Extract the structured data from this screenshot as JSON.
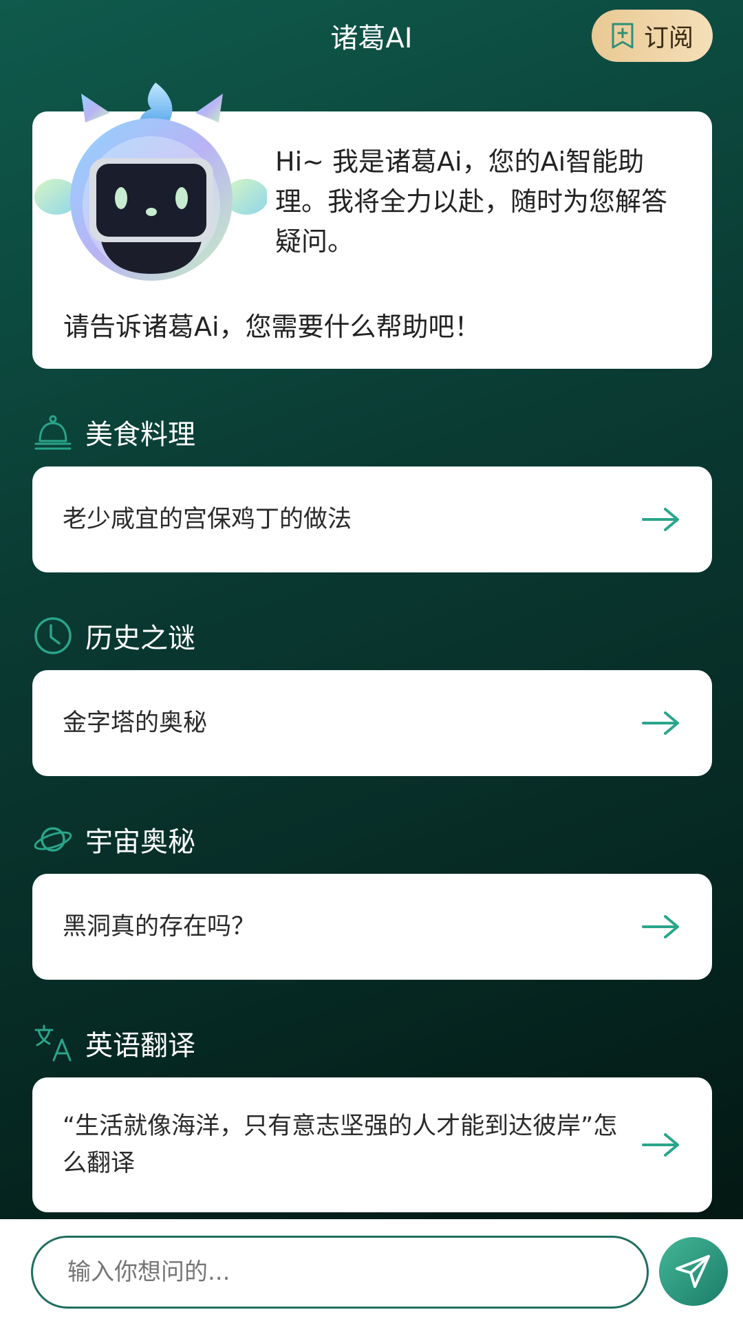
{
  "header": {
    "title": "诸葛AI",
    "subscribe_label": "订阅"
  },
  "welcome": {
    "intro": "Hi~ 我是诸葛Ai，您的Ai智能助理。我将全力以赴，随时为您解答疑问。",
    "prompt": "请告诉诸葛Ai，您需要什么帮助吧！"
  },
  "sections": [
    {
      "title": "美食料理",
      "icon": "bell-cloche-icon",
      "suggestion": "老少咸宜的宫保鸡丁的做法"
    },
    {
      "title": "历史之谜",
      "icon": "clock-icon",
      "suggestion": "金字塔的奥秘"
    },
    {
      "title": "宇宙奥秘",
      "icon": "planet-icon",
      "suggestion": "黑洞真的存在吗？"
    },
    {
      "title": "英语翻译",
      "icon": "translate-icon",
      "suggestion": "“生活就像海洋，只有意志坚强的人才能到达彼岸”怎么翻译"
    }
  ],
  "input": {
    "value": "",
    "placeholder": "输入你想问的..."
  },
  "colors": {
    "accent": "#2aa58a",
    "subscribe_bg": "#f1d8ab",
    "bg_top": "#0f5a4c",
    "bg_bottom": "#03130f"
  }
}
